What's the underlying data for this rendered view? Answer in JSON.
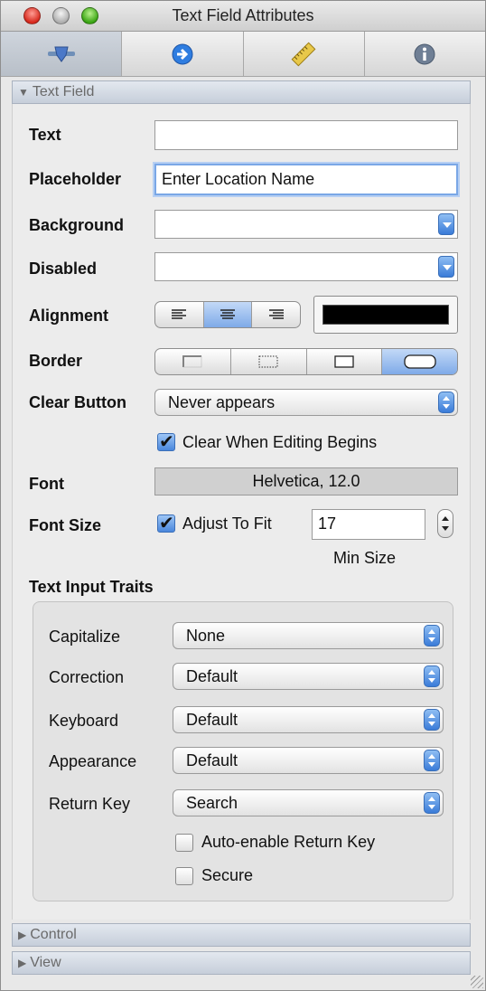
{
  "window": {
    "title": "Text Field Attributes"
  },
  "tabs": [
    {
      "icon": "identity-icon",
      "active": true
    },
    {
      "icon": "connections-icon",
      "active": false
    },
    {
      "icon": "size-ruler-icon",
      "active": false
    },
    {
      "icon": "info-icon",
      "active": false
    }
  ],
  "sections": {
    "text_field": "Text Field",
    "control": "Control",
    "view": "View"
  },
  "fields": {
    "text_label": "Text",
    "text_value": "",
    "placeholder_label": "Placeholder",
    "placeholder_value": "Enter Location Name",
    "background_label": "Background",
    "background_value": "",
    "disabled_label": "Disabled",
    "disabled_value": "",
    "alignment_label": "Alignment",
    "alignment_selected": "center",
    "text_color": "#000000",
    "border_label": "Border",
    "border_selected": "rounded",
    "clear_button_label": "Clear Button",
    "clear_button_value": "Never appears",
    "clear_when_editing": {
      "label": "Clear When Editing Begins",
      "checked": true
    },
    "font_label": "Font",
    "font_value": "Helvetica, 12.0",
    "font_size_label": "Font Size",
    "adjust_to_fit": {
      "label": "Adjust To Fit",
      "checked": true
    },
    "min_size_value": "17",
    "min_size_caption": "Min Size"
  },
  "traits": {
    "heading": "Text Input Traits",
    "capitalize_label": "Capitalize",
    "capitalize_value": "None",
    "correction_label": "Correction",
    "correction_value": "Default",
    "keyboard_label": "Keyboard",
    "keyboard_value": "Default",
    "appearance_label": "Appearance",
    "appearance_value": "Default",
    "return_key_label": "Return Key",
    "return_key_value": "Search",
    "auto_enable": {
      "label": "Auto-enable Return Key",
      "checked": false
    },
    "secure": {
      "label": "Secure",
      "checked": false
    }
  },
  "colors": {
    "accent": "#3a7bd8",
    "section_header": "#c6ceda"
  }
}
